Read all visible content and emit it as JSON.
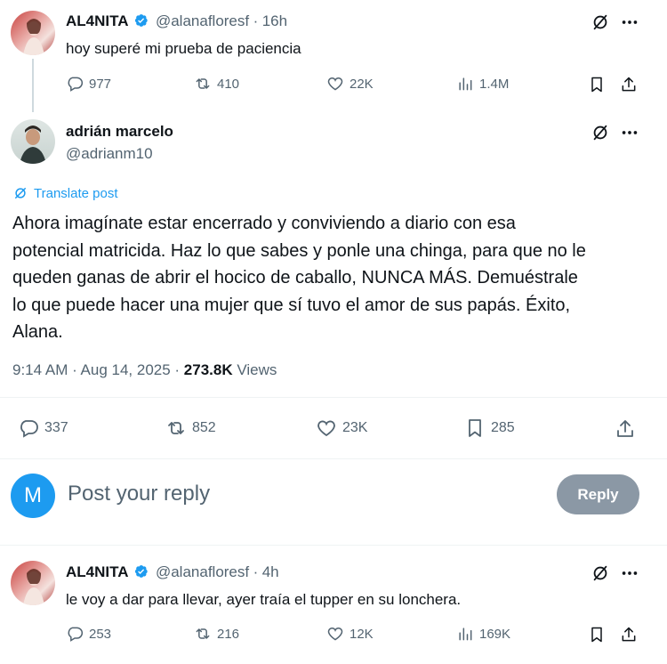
{
  "parent_tweet": {
    "author_name": "AL4NITA",
    "handle": "@alanafloresf",
    "separator": "·",
    "time": "16h",
    "text": "hoy superé mi prueba de paciencia",
    "stats": {
      "replies": "977",
      "reposts": "410",
      "likes": "22K",
      "views": "1.4M"
    }
  },
  "main_tweet": {
    "author_name": "adrián marcelo",
    "handle": "@adrianm10",
    "translate_label": "Translate post",
    "lines": [
      "Ahora imagínate estar encerrado y conviviendo a diario con esa",
      "potencial matricida. Haz lo que sabes y ponle una chinga, para que no le",
      "queden ganas de abrir el hocico de caballo, NUNCA MÁS. Demuéstrale",
      "lo que puede hacer una mujer que sí tuvo el amor de sus papás. Éxito,",
      "Alana."
    ],
    "timestamp": "9:14 AM · Aug 14, 2025 · ",
    "view_count": "273.8K",
    "views_label": " Views",
    "stats": {
      "replies": "337",
      "reposts": "852",
      "likes": "23K",
      "bookmarks": "285"
    }
  },
  "reply_box": {
    "avatar_letter": "M",
    "placeholder": "Post your reply",
    "button_label": "Reply"
  },
  "reply_tweet": {
    "author_name": "AL4NITA",
    "handle": "@alanafloresf",
    "separator": "·",
    "time": "4h",
    "text": "le voy a dar para llevar, ayer traía el tupper en su lonchera.",
    "stats": {
      "replies": "253",
      "reposts": "216",
      "likes": "12K",
      "views": "169K"
    }
  },
  "colors": {
    "accent": "#1d9bf0",
    "secondary_text": "#536471",
    "reply_button": "#8b98a5",
    "reply_avatar": "#1d9bf0"
  },
  "icons": [
    "reply-icon",
    "repost-icon",
    "like-icon",
    "views-icon",
    "bookmark-icon",
    "share-icon",
    "grok-icon",
    "more-icon",
    "verified-icon",
    "translate-icon"
  ]
}
